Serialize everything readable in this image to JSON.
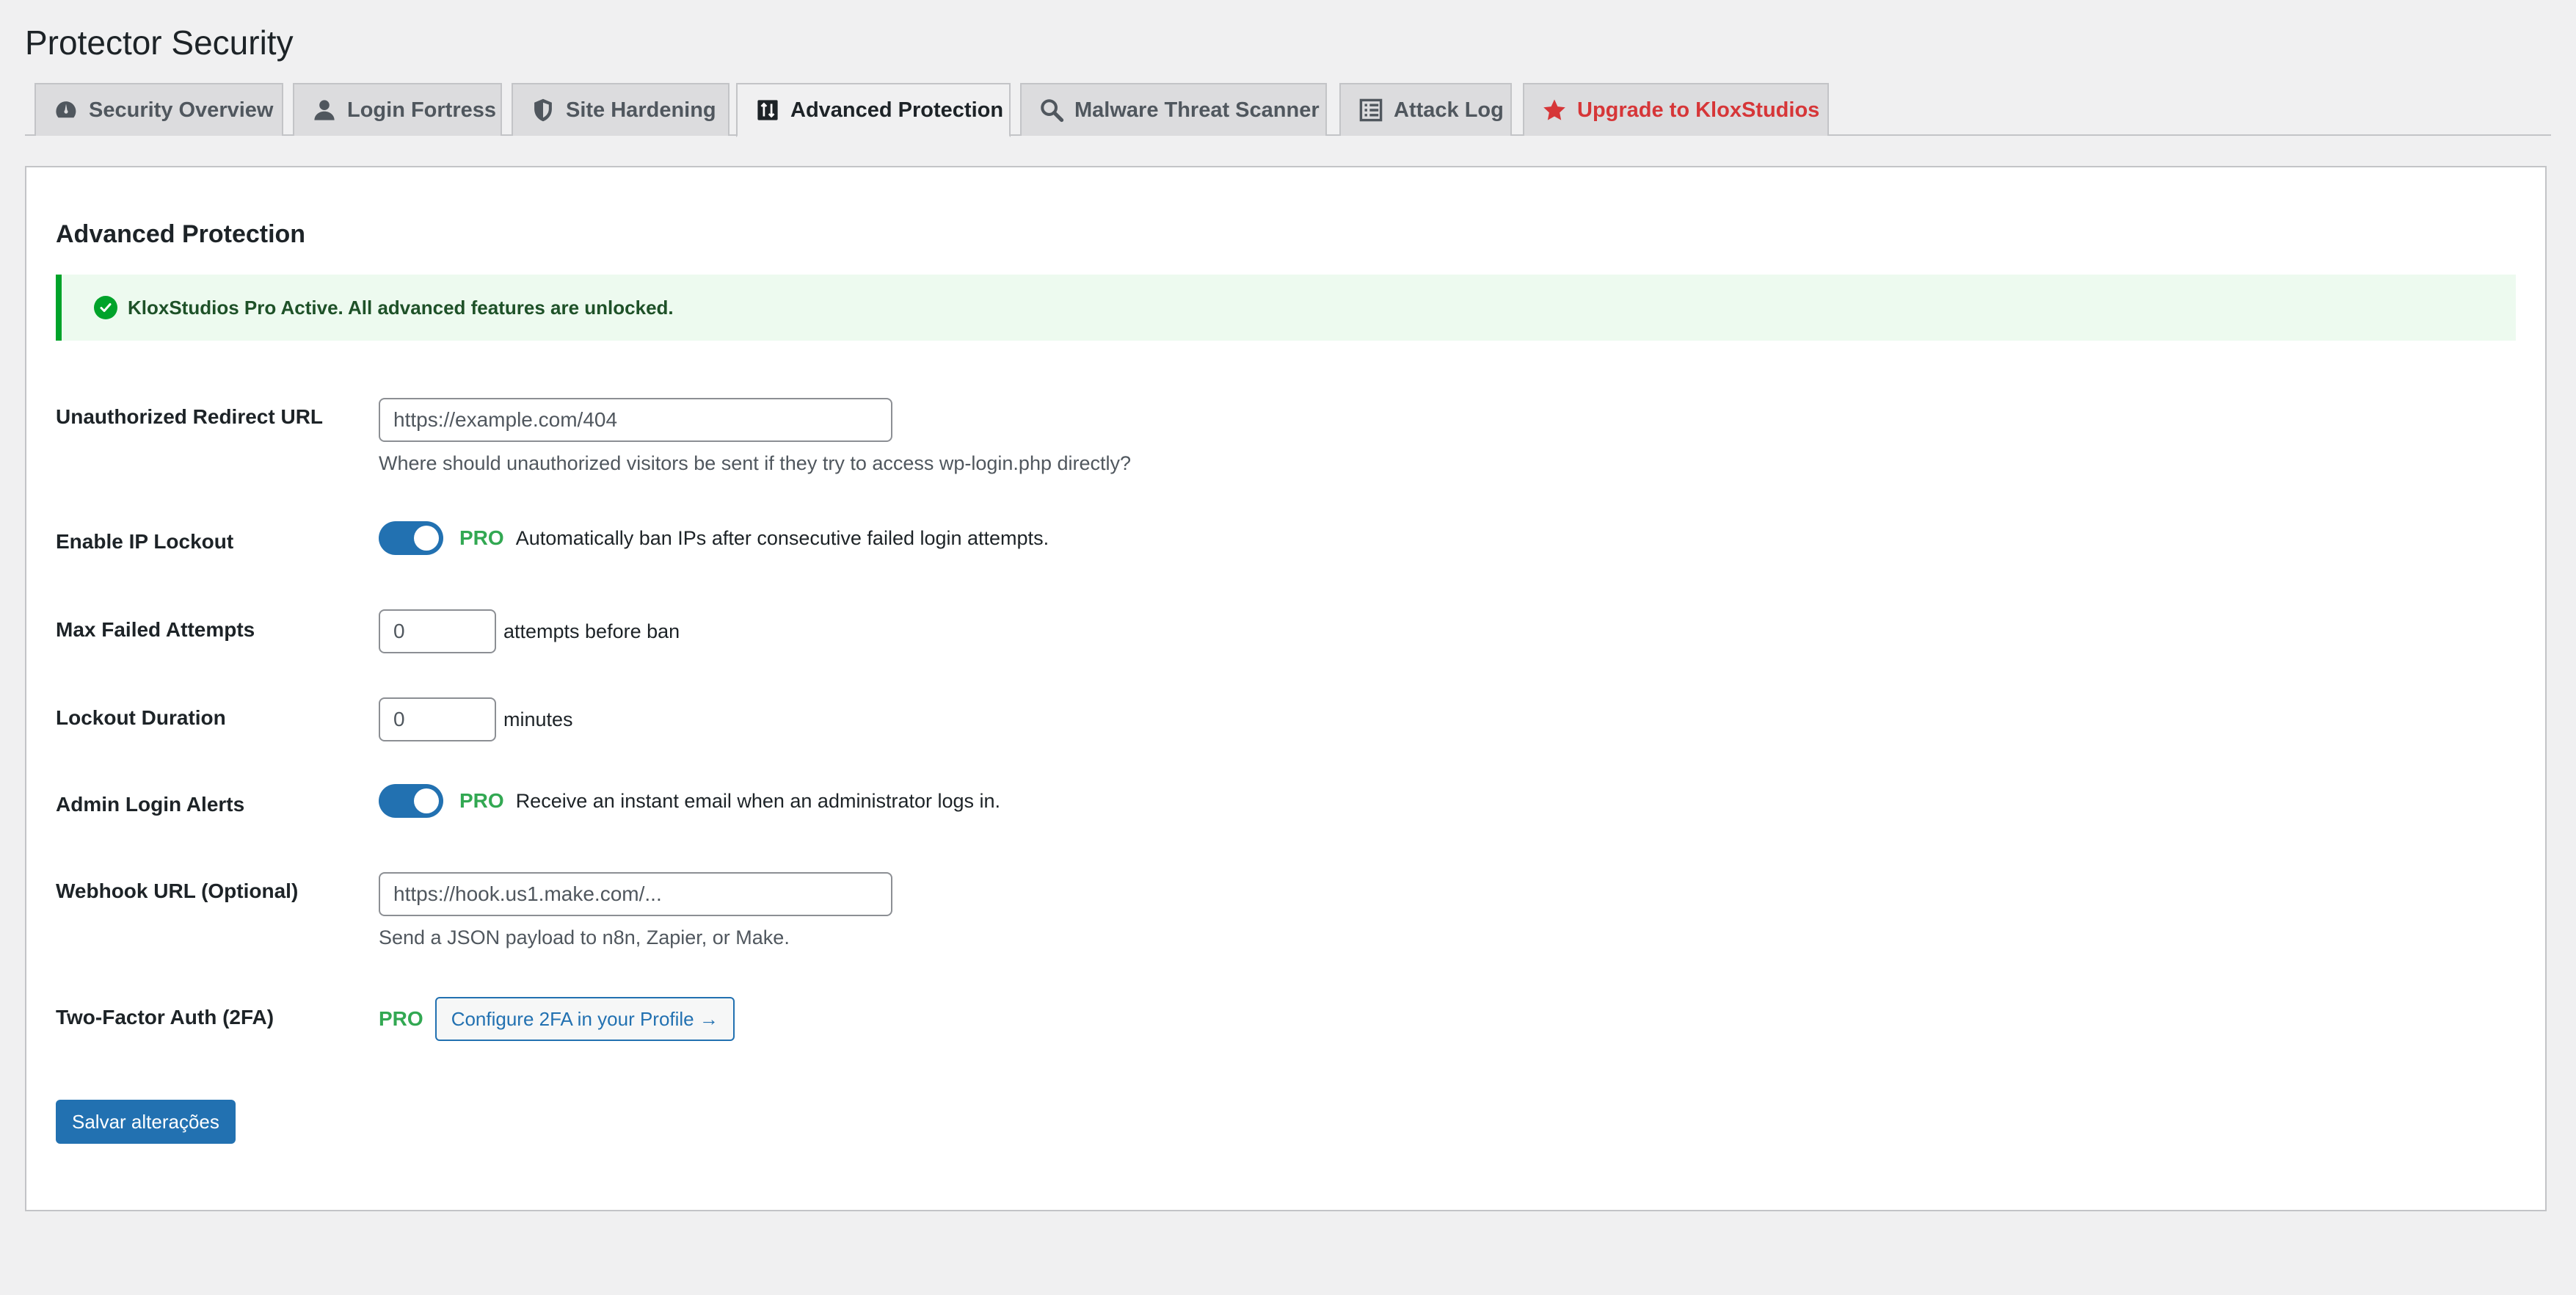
{
  "page": {
    "title": "Protector Security"
  },
  "tabs": [
    {
      "label": "Security Overview",
      "icon": "dashboard-gauge-icon"
    },
    {
      "label": "Login Fortress",
      "icon": "user-icon"
    },
    {
      "label": "Site Hardening",
      "icon": "shield-icon"
    },
    {
      "label": "Advanced Protection",
      "icon": "code-standards-icon",
      "active": true
    },
    {
      "label": "Malware Threat Scanner",
      "icon": "search-icon"
    },
    {
      "label": "Attack Log",
      "icon": "list-view-icon"
    },
    {
      "label": "Upgrade to KloxStudios",
      "icon": "star-icon",
      "color": "#d63638"
    }
  ],
  "card": {
    "title": "Advanced Protection",
    "notice": "KloxStudios Pro Active. All advanced features are unlocked."
  },
  "fields": {
    "redirect": {
      "label": "Unauthorized Redirect URL",
      "value": "https://example.com/404",
      "description": "Where should unauthorized visitors be sent if they try to access wp-login.php directly?"
    },
    "ip_lockout": {
      "label": "Enable IP Lockout",
      "enabled": true,
      "badge": "PRO",
      "description": "Automatically ban IPs after consecutive failed login attempts."
    },
    "max_attempts": {
      "label": "Max Failed Attempts",
      "value": "0",
      "suffix": "attempts before ban"
    },
    "lockout_duration": {
      "label": "Lockout Duration",
      "value": "0",
      "suffix": "minutes"
    },
    "admin_alerts": {
      "label": "Admin Login Alerts",
      "enabled": true,
      "badge": "PRO",
      "description": "Receive an instant email when an administrator logs in."
    },
    "webhook": {
      "label": "Webhook URL (Optional)",
      "value": "https://hook.us1.make.com/...",
      "description": "Send a JSON payload to n8n, Zapier, or Make."
    },
    "two_factor": {
      "label": "Two-Factor Auth (2FA)",
      "badge": "PRO",
      "button": "Configure 2FA in your Profile →"
    }
  },
  "save_button": "Salvar alterações",
  "colors": {
    "accent": "#2271b1",
    "pro_green": "#32a852",
    "success_border": "#00a32a",
    "upgrade_red": "#d63638"
  }
}
